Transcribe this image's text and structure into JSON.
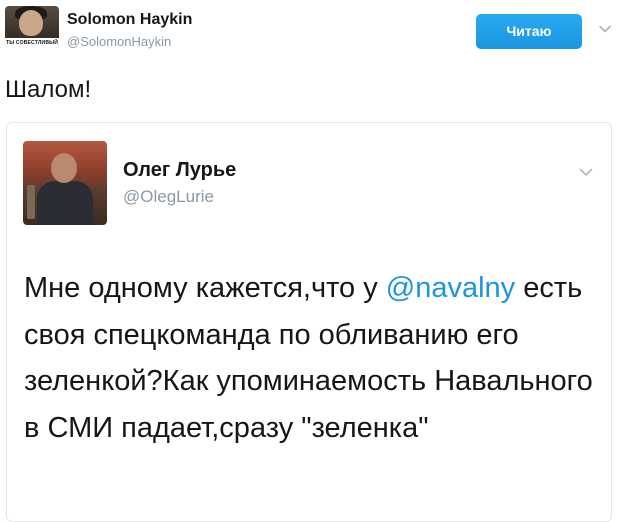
{
  "tweet": {
    "author": {
      "name": "Solomon Haykin",
      "handle": "@SolomonHaykin",
      "avatar_caption": "ТЫ СОВЕСТЛИВЫЙ"
    },
    "follow_button": {
      "label": "Читаю",
      "color": "#1da1f2"
    },
    "menu_icon": "chevron-down-icon",
    "text": "Шалом!"
  },
  "quoted_tweet": {
    "author": {
      "name": "Олег Лурье",
      "handle": "@OlegLurie"
    },
    "menu_icon": "chevron-down-icon",
    "text_before_mention": "Мне одному кажется,что у ",
    "mention": "@navalny",
    "text_after_mention": " есть своя спецкоманда по обливанию его зеленкой?Как упоминаемость Навального в СМИ падает,сразу \"зеленка\""
  },
  "colors": {
    "link": "#1b95e0",
    "text": "#14171a",
    "secondary_text": "#8899a6",
    "border": "#e1e8ed"
  }
}
